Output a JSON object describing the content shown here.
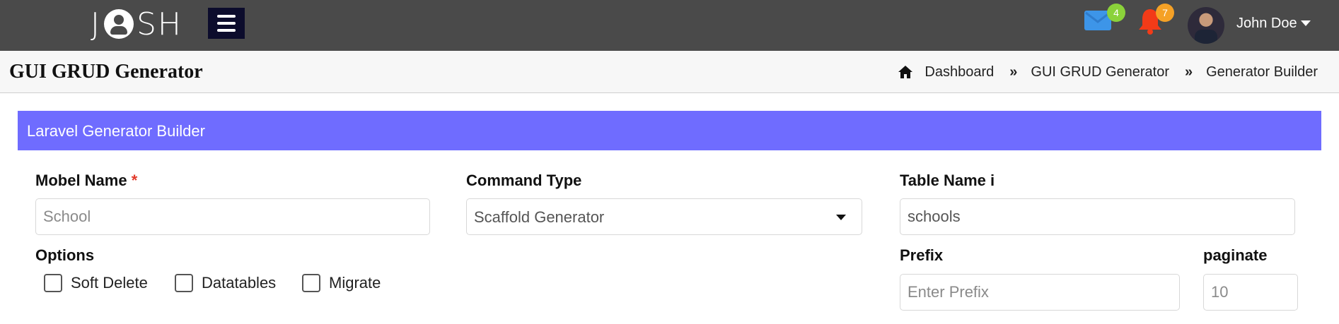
{
  "header": {
    "logo_text": "J•SH",
    "mail_count": "4",
    "notif_count": "7",
    "user_name": "John Doe",
    "colors": {
      "bar": "#4a4a4a",
      "mail_icon": "#3d95e8",
      "bell_icon": "#f23b18"
    }
  },
  "page": {
    "title": "GUI GRUD Generator",
    "breadcrumb": {
      "separator": "»",
      "items": [
        "Dashboard",
        "GUI GRUD Generator",
        "Generator Builder"
      ]
    }
  },
  "panel": {
    "title": "Laravel Generator Builder",
    "accent": "#6f6cff",
    "model_name": {
      "label": "Mobel Name",
      "required": "*",
      "placeholder": "School"
    },
    "command_type": {
      "label": "Command Type",
      "value": "Scaffold Generator"
    },
    "table_name": {
      "label": "Table Name i",
      "value": "schools"
    },
    "options": {
      "label": "Options",
      "items": [
        "Soft Delete",
        "Datatables",
        "Migrate"
      ]
    },
    "prefix": {
      "label": "Prefix",
      "placeholder": "Enter Prefix"
    },
    "paginate": {
      "label": "paginate",
      "placeholder": "10"
    }
  }
}
